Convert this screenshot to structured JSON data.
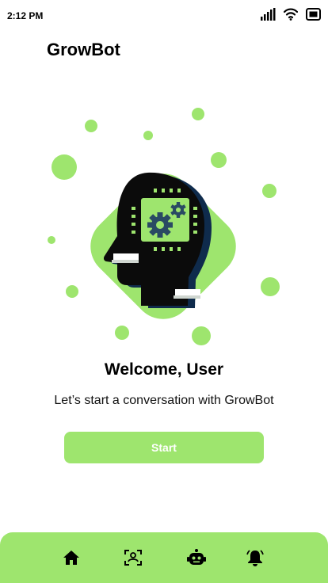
{
  "status_bar": {
    "time": "2:12 PM",
    "icons": [
      "signal-icon",
      "wifi-icon",
      "battery-icon"
    ]
  },
  "header": {
    "title": "GrowBot"
  },
  "hero": {
    "image": "ai-head-gears-illustration"
  },
  "welcome": {
    "heading": "Welcome, User",
    "subtitle": "Let’s start a conversation with GrowBot",
    "start_label": "Start"
  },
  "bottom_nav": {
    "items": [
      {
        "icon": "home-icon"
      },
      {
        "icon": "scan-icon"
      },
      {
        "icon": "bot-icon"
      },
      {
        "icon": "bell-icon"
      }
    ]
  },
  "colors": {
    "accent": "#9ee56e",
    "dark": "#0b0b0b",
    "navy": "#0f2b4c",
    "chip": "#2a4a63"
  }
}
